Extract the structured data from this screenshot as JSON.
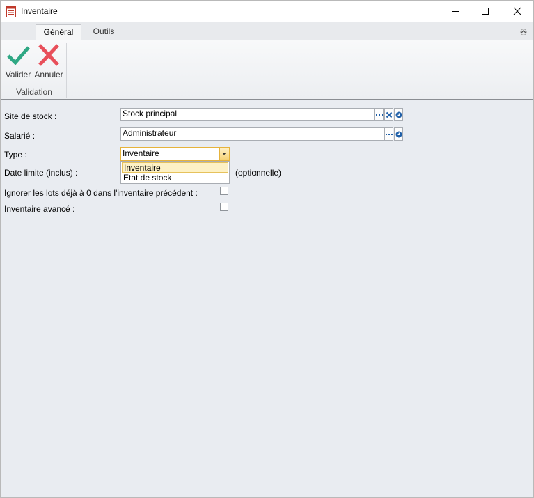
{
  "window": {
    "title": "Inventaire",
    "icon": "inventory-doc-icon"
  },
  "ribbon": {
    "tabs": [
      {
        "label": "Général",
        "active": true
      },
      {
        "label": "Outils",
        "active": false
      }
    ],
    "group": {
      "label": "Validation",
      "buttons": [
        {
          "label": "Valider",
          "icon": "check-icon",
          "color": "#2fa884"
        },
        {
          "label": "Annuler",
          "icon": "close-x-icon",
          "color": "#e84f5a"
        }
      ]
    }
  },
  "form": {
    "site_de_stock": {
      "label": "Site de stock :",
      "value": "Stock principal"
    },
    "salarie": {
      "label": "Salarié :",
      "value": "Administrateur"
    },
    "type": {
      "label": "Type :",
      "value": "Inventaire",
      "options": [
        "Inventaire",
        "Etat de stock"
      ]
    },
    "date_limite": {
      "label": "Date limite (inclus) :",
      "hint": "(optionnelle)"
    },
    "ignorer_lots": {
      "label": "Ignorer les lots déjà à 0 dans l'inventaire précédent :",
      "checked": false
    },
    "inventaire_avance": {
      "label": "Inventaire avancé :",
      "checked": false
    }
  },
  "colors": {
    "accent_combo": "#e6b33c",
    "selected_item": "#fdf1c5",
    "form_background": "#e9ecf1"
  }
}
